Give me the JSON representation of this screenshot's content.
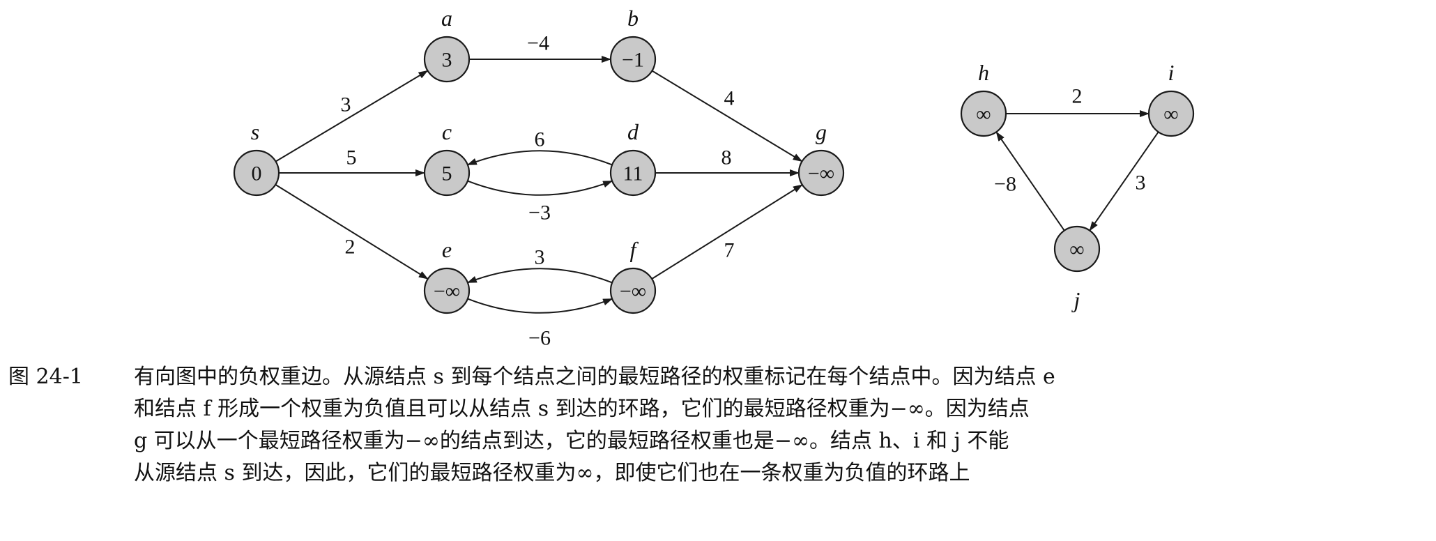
{
  "figure": {
    "label": "图 24-1",
    "caption_lines": [
      "有向图中的负权重边。从源结点 s 到每个结点之间的最短路径的权重标记在每个结点中。因为结点 e",
      "和结点 f 形成一个权重为负值且可以从结点 s 到达的环路，它们的最短路径权重为−∞。因为结点",
      "g 可以从一个最短路径权重为−∞的结点到达，它的最短路径权重也是−∞。结点 h、i 和 j 不能",
      "从源结点 s 到达，因此，它们的最短路径权重为∞，即使它们也在一条权重为负值的环路上"
    ]
  },
  "graph": {
    "nodes": [
      {
        "id": "s",
        "name": "s",
        "value": "0"
      },
      {
        "id": "a",
        "name": "a",
        "value": "3"
      },
      {
        "id": "b",
        "name": "b",
        "value": "−1"
      },
      {
        "id": "c",
        "name": "c",
        "value": "5"
      },
      {
        "id": "d",
        "name": "d",
        "value": "11"
      },
      {
        "id": "e",
        "name": "e",
        "value": "−∞"
      },
      {
        "id": "f",
        "name": "f",
        "value": "−∞"
      },
      {
        "id": "g",
        "name": "g",
        "value": "−∞"
      },
      {
        "id": "h",
        "name": "h",
        "value": "∞"
      },
      {
        "id": "i",
        "name": "i",
        "value": "∞"
      },
      {
        "id": "j",
        "name": "j",
        "value": "∞"
      }
    ],
    "edges": [
      {
        "from": "s",
        "to": "a",
        "weight": "3"
      },
      {
        "from": "s",
        "to": "c",
        "weight": "5"
      },
      {
        "from": "s",
        "to": "e",
        "weight": "2"
      },
      {
        "from": "a",
        "to": "b",
        "weight": "−4"
      },
      {
        "from": "b",
        "to": "g",
        "weight": "4"
      },
      {
        "from": "c",
        "to": "d",
        "weight": "6"
      },
      {
        "from": "d",
        "to": "c",
        "weight": "−3"
      },
      {
        "from": "d",
        "to": "g",
        "weight": "8"
      },
      {
        "from": "e",
        "to": "f",
        "weight": "3"
      },
      {
        "from": "f",
        "to": "e",
        "weight": "−6"
      },
      {
        "from": "f",
        "to": "g",
        "weight": "7"
      },
      {
        "from": "h",
        "to": "i",
        "weight": "2"
      },
      {
        "from": "i",
        "to": "j",
        "weight": "3"
      },
      {
        "from": "j",
        "to": "h",
        "weight": "−8"
      }
    ]
  }
}
